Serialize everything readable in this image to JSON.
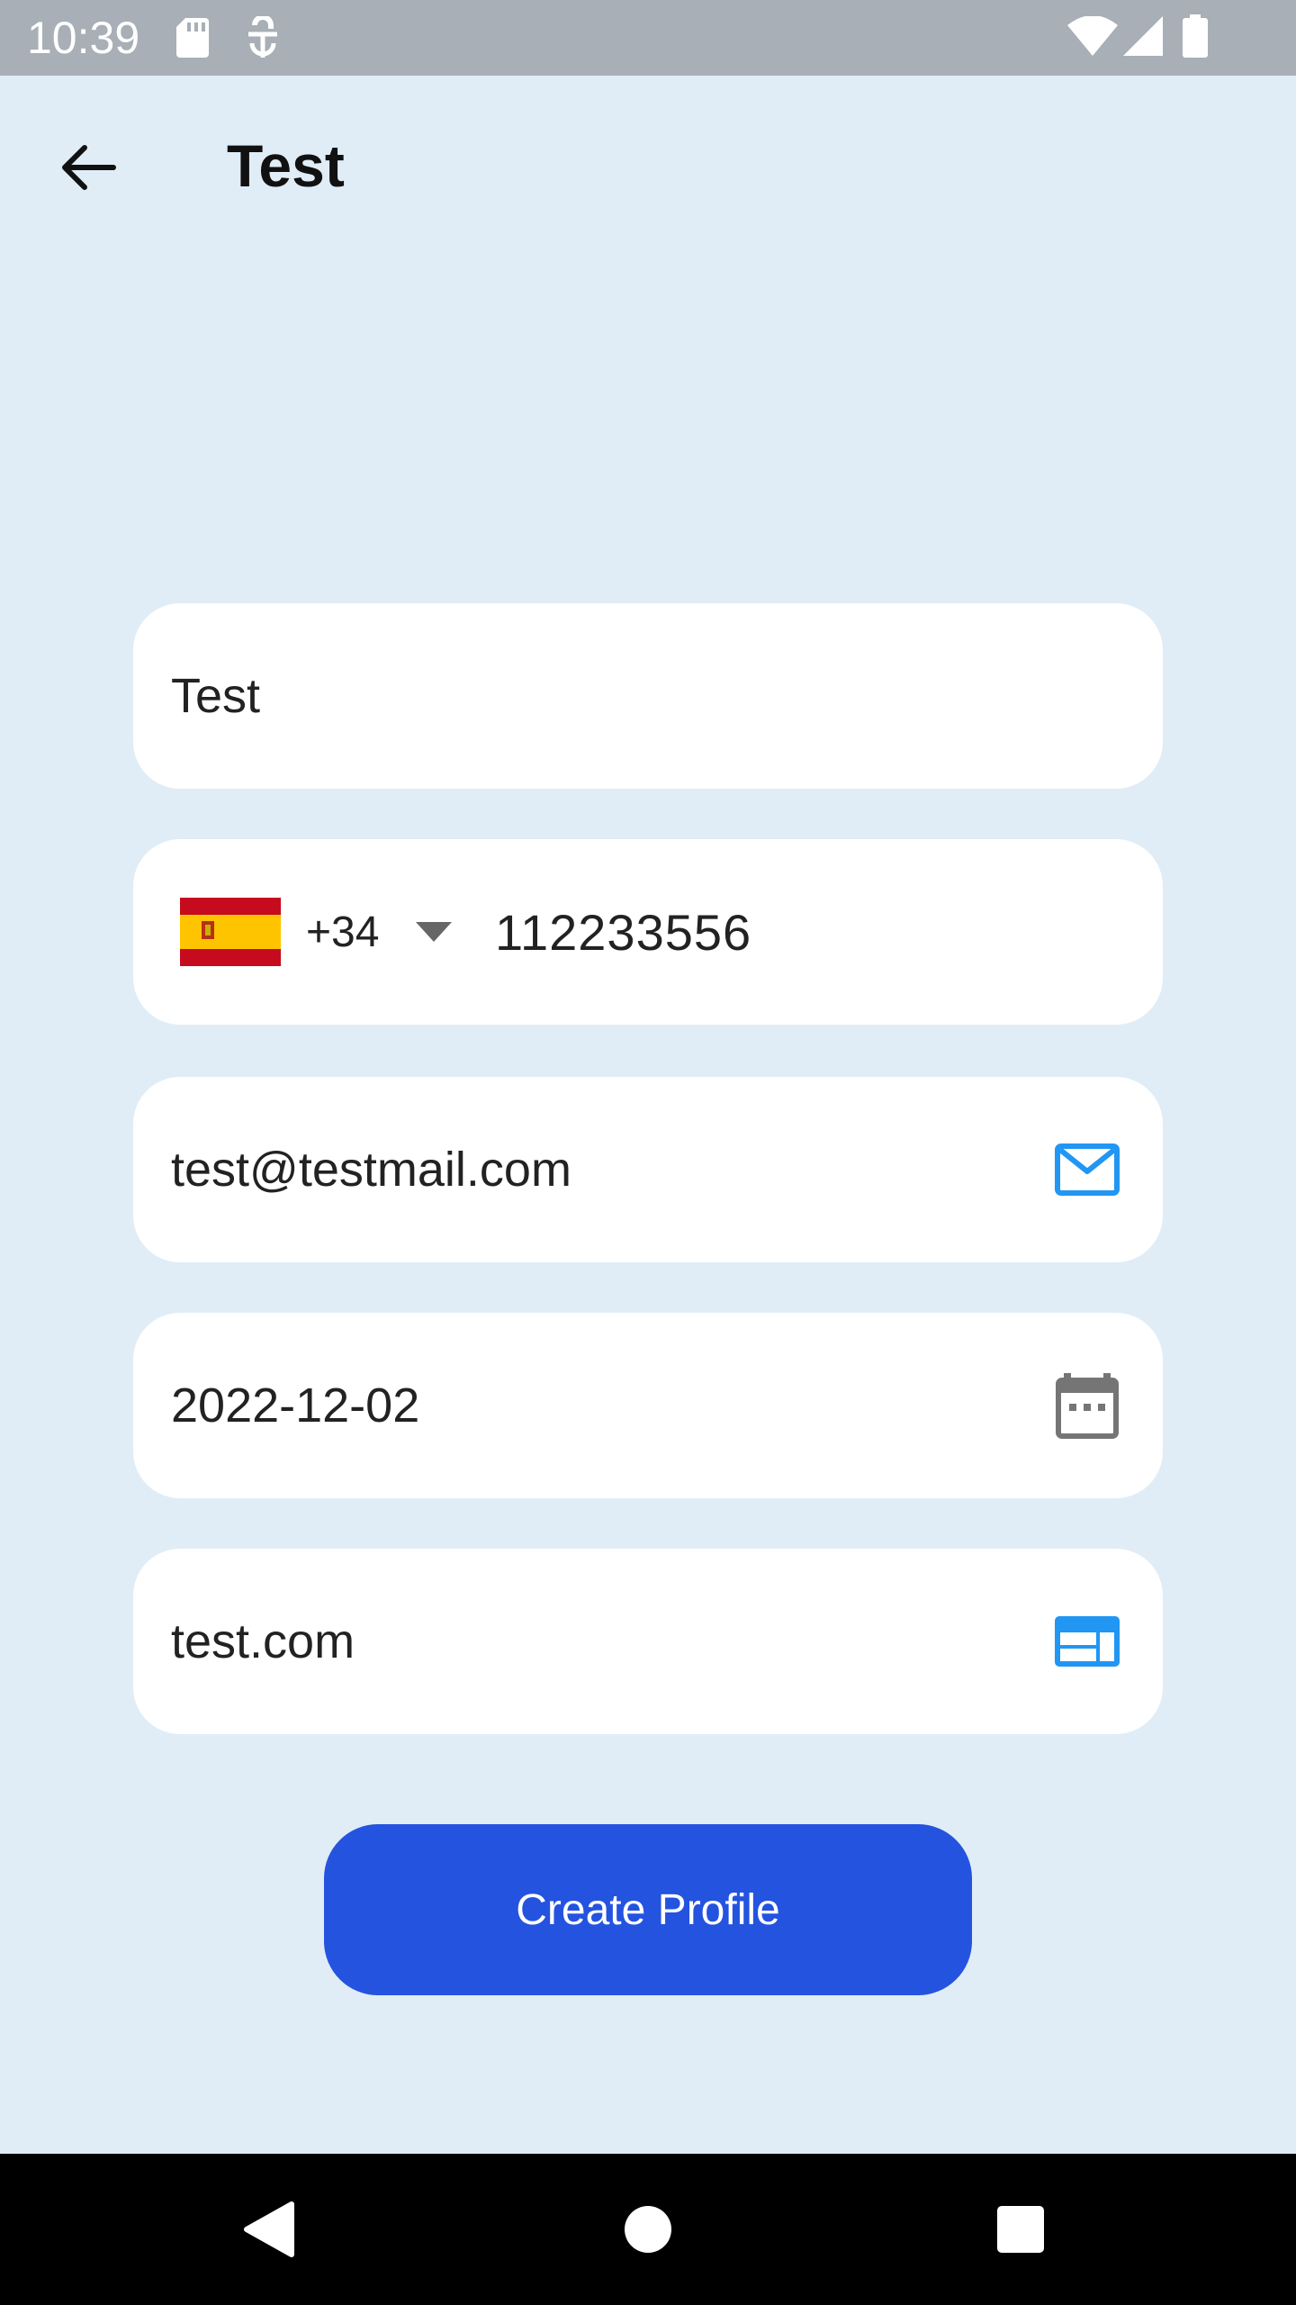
{
  "status_bar": {
    "time": "10:39",
    "left_icons": [
      "sd-card-icon",
      "vpn-key-icon"
    ],
    "right_icons": [
      "wifi-icon",
      "cellular-signal-icon",
      "battery-icon"
    ]
  },
  "app_bar": {
    "back_icon": "arrow-left-icon",
    "title": "Test"
  },
  "form": {
    "name_value": "Test",
    "phone": {
      "country_flag": "spain-flag",
      "dial_code": "+34",
      "number": "112233556"
    },
    "email_value": "test@testmail.com",
    "email_icon": "mail-icon",
    "date_value": "2022-12-02",
    "date_icon": "calendar-icon",
    "website_value": "test.com",
    "website_icon": "web-icon"
  },
  "create_button_label": "Create Profile",
  "nav_bar": {
    "icons": [
      "back-triangle-icon",
      "home-circle-icon",
      "recents-square-icon"
    ]
  },
  "colors": {
    "background": "#e0edf6",
    "status_bar": "#a8afb6",
    "primary_button": "#2453e0",
    "accent_icon": "#2196f3",
    "field_bg": "#ffffff"
  }
}
